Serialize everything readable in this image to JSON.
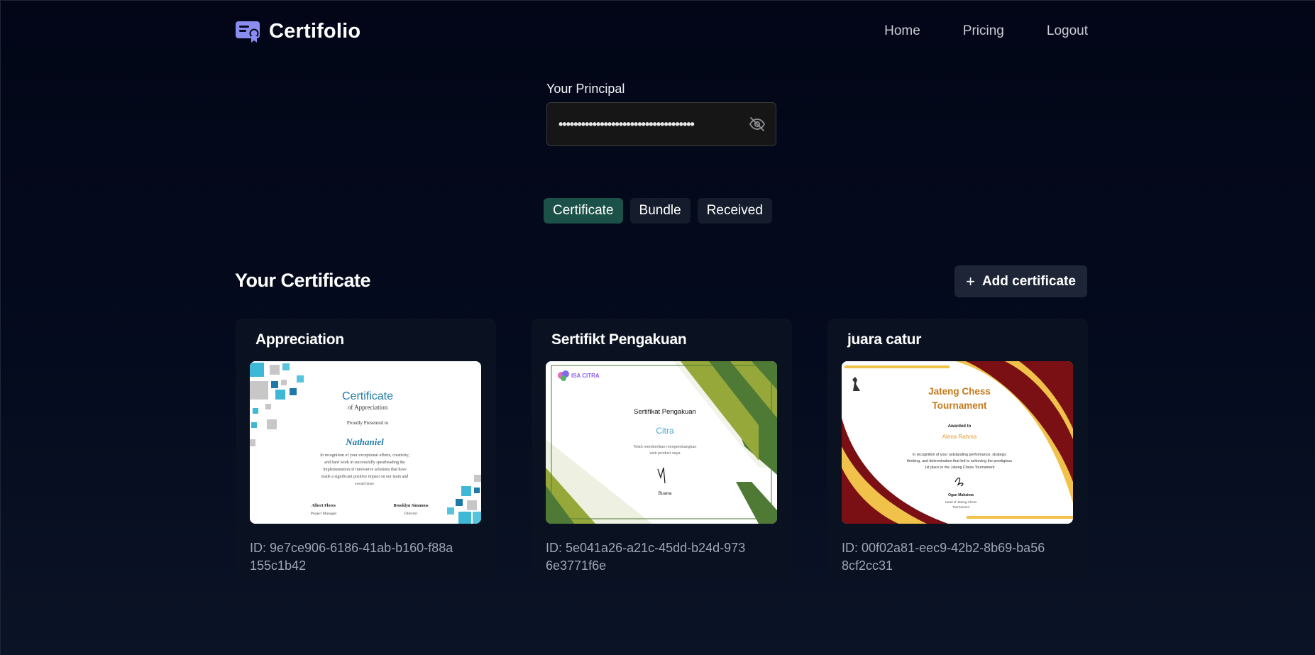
{
  "app": {
    "name": "Certifolio",
    "nav": [
      {
        "label": "Home"
      },
      {
        "label": "Pricing"
      },
      {
        "label": "Logout"
      }
    ]
  },
  "principal": {
    "label": "Your Principal",
    "value": "••••••••••••••••••••••••••••••••••••"
  },
  "tabs": [
    {
      "label": "Certificate",
      "active": true
    },
    {
      "label": "Bundle",
      "active": false
    },
    {
      "label": "Received",
      "active": false
    }
  ],
  "section": {
    "title": "Your Certificate",
    "add_button_label": "Add certificate"
  },
  "certificates": [
    {
      "title": "Appreciation",
      "id_text": "ID: 9e7ce906-6186-41ab-b160-f88a155c1b42",
      "thumb": {
        "heading": "Certificate",
        "subheading": "of Appreciation",
        "presented": "Proudly Presented to",
        "recipient": "Nathaniel",
        "body": [
          "In recognition of your exceptional efforts, creativity,",
          "and hard work in successfully spearheading the",
          "implementation of innovative solutions that have",
          "made a significant positive impact on our team and",
          "overall future."
        ],
        "signer1_name": "Albert Flores",
        "signer1_role": "Project Manager",
        "signer2_name": "Brooklyn Simmons",
        "signer2_role": "Director"
      }
    },
    {
      "title": "Sertifikt Pengakuan",
      "id_text": "ID: 5e041a26-a21c-45dd-b24d-9736e3771f6e",
      "thumb": {
        "brand": "ISA CITRA",
        "heading": "Sertifikat Pengakuan",
        "recipient": "Citra",
        "body": [
          "Telah memberikan mengembangkan",
          "web product saya"
        ],
        "signer": "Buana"
      }
    },
    {
      "title": "juara catur",
      "id_text": "ID: 00f02a81-eec9-42b2-8b69-ba568cf2cc31",
      "thumb": {
        "heading_line1": "Jateng Chess",
        "heading_line2": "Tournament",
        "awarded": "Awarded to",
        "recipient": "Alena Rahma",
        "body": [
          "In recognition of your outstanding performance, strategic",
          "thinking, and determination that led to achieving the prestigious",
          "1st place in the Jateng Chess Tournament"
        ],
        "signer": "Ogan Mahatma",
        "signer_role_line1": "Head of Jateng Chess",
        "signer_role_line2": "Tournament"
      }
    }
  ],
  "colors": {
    "background": "#020617",
    "active_tab": "#1b5148",
    "tab": "#151c2b",
    "card": "#0a1121",
    "brand_logo": "#8b8cf0"
  },
  "icons": {
    "brand": "certificate-icon",
    "eye_toggle": "eye-off-icon",
    "add": "plus-icon"
  }
}
